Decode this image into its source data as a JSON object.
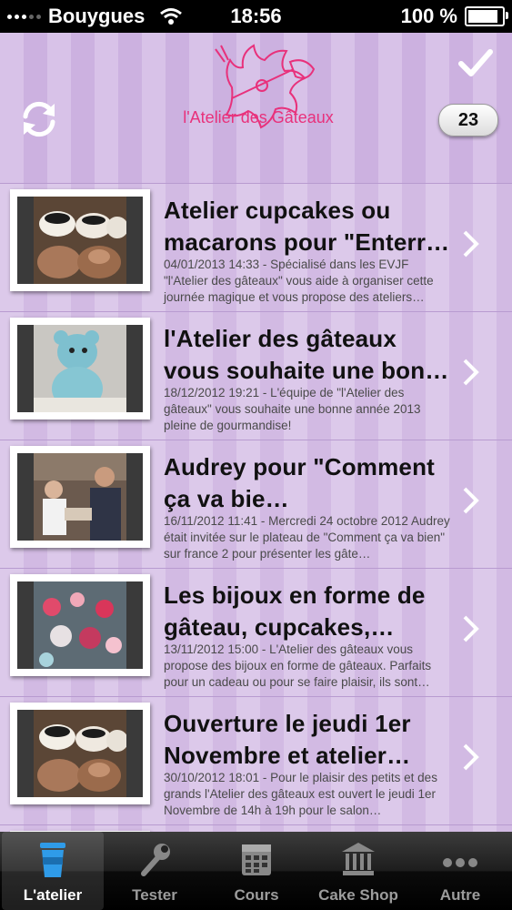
{
  "status": {
    "carrier": "Bouygues",
    "time": "18:56",
    "battery": "100 %",
    "battery_level": 1.0
  },
  "header": {
    "logo_text": "l'Atelier des Gâteaux",
    "badge": "23"
  },
  "articles": [
    {
      "title": "Atelier cupcakes ou macarons pour \"Enterr…",
      "desc": "04/01/2013 14:33 - Spécialisé dans les EVJF \"l'Atelier des gâteaux\" vous aide à organiser cette journée magique et vous propose des ateliers…",
      "thumb": "cupcakes"
    },
    {
      "title": "l'Atelier des gâteaux vous souhaite une bon…",
      "desc": "18/12/2012 19:21 - L'équipe de \"l'Atelier des gâteaux\" vous souhaite une bonne année 2013 pleine de gourmandise!",
      "thumb": "bear"
    },
    {
      "title": "Audrey pour \"Comment ça va bie…",
      "desc": "16/11/2012 11:41 - Mercredi 24 octobre 2012 Audrey était invitée sur le plateau de \"Comment ça va bien\" sur france 2 pour présenter les gâte…",
      "thumb": "tv"
    },
    {
      "title": "Les bijoux en forme de gâteau, cupcakes,…",
      "desc": "13/11/2012 15:00 - L'Atelier des gâteaux vous propose des bijoux en forme de gâteaux. Parfaits pour un cadeau ou pour se faire plaisir, ils sont…",
      "thumb": "jewels"
    },
    {
      "title": "Ouverture le jeudi 1er Novembre et atelier…",
      "desc": "30/10/2012 18:01 - Pour le plaisir des petits et des grands l'Atelier des gâteaux est ouvert le jeudi 1er Novembre de 14h à 19h pour le salon…",
      "thumb": "cupcakes"
    }
  ],
  "tabs": [
    {
      "label": "L'atelier",
      "icon": "cup-icon"
    },
    {
      "label": "Tester",
      "icon": "wrench-icon"
    },
    {
      "label": "Cours",
      "icon": "calendar-icon"
    },
    {
      "label": "Cake Shop",
      "icon": "bank-icon"
    },
    {
      "label": "Autre",
      "icon": "more-icon"
    }
  ],
  "colors": {
    "accent": "#e8317b",
    "stripe_a": "#d8c2e8",
    "stripe_b": "#ccb1e0"
  }
}
